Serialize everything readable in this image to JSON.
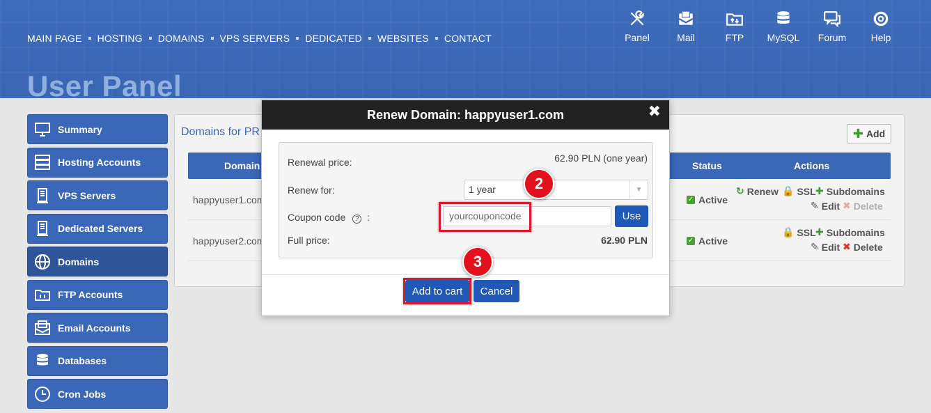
{
  "nav": {
    "items": [
      "MAIN PAGE",
      "HOSTING",
      "DOMAINS",
      "VPS SERVERS",
      "DEDICATED",
      "WEBSITES",
      "CONTACT"
    ]
  },
  "tools": [
    {
      "label": "Panel",
      "icon": "tools-icon"
    },
    {
      "label": "Mail",
      "icon": "mail-icon"
    },
    {
      "label": "FTP",
      "icon": "ftp-folder-icon"
    },
    {
      "label": "MySQL",
      "icon": "database-icon"
    },
    {
      "label": "Forum",
      "icon": "forum-icon"
    },
    {
      "label": "Help",
      "icon": "lifebuoy-icon"
    }
  ],
  "page_title": "User Panel",
  "sidebar": {
    "items": [
      {
        "label": "Summary",
        "icon": "monitor-icon"
      },
      {
        "label": "Hosting Accounts",
        "icon": "server-icon"
      },
      {
        "label": "VPS Servers",
        "icon": "vps-icon"
      },
      {
        "label": "Dedicated Servers",
        "icon": "dedicated-icon"
      },
      {
        "label": "Domains",
        "icon": "www-globe-icon",
        "active": true
      },
      {
        "label": "FTP Accounts",
        "icon": "ftp-folder-icon"
      },
      {
        "label": "Email Accounts",
        "icon": "email-icon"
      },
      {
        "label": "Databases",
        "icon": "database-icon"
      },
      {
        "label": "Cron Jobs",
        "icon": "clock-icon"
      }
    ]
  },
  "panel": {
    "title": "Domains for PR",
    "add_label": "Add",
    "columns": {
      "domain": "Domain",
      "status": "Status",
      "actions": "Actions"
    },
    "rows": [
      {
        "domain": "happyuser1.com",
        "status": "Active",
        "actions": {
          "renew": "Renew",
          "ssl": "SSL",
          "subdomains": "Subdomains",
          "edit": "Edit",
          "delete": "Delete"
        }
      },
      {
        "domain": "happyuser2.com",
        "status": "Active",
        "actions": {
          "ssl": "SSL",
          "subdomains": "Subdomains",
          "edit": "Edit",
          "delete": "Delete"
        }
      }
    ]
  },
  "modal": {
    "title": "Renew Domain: happyuser1.com",
    "renewal_price_label": "Renewal price:",
    "renewal_price_value": "62.90 PLN (one year)",
    "renew_for_label": "Renew for:",
    "renew_for_value": "1 year",
    "coupon_label": "Coupon code",
    "coupon_colon": ":",
    "coupon_value": "yourcouponcode",
    "use_label": "Use",
    "full_price_label": "Full price:",
    "full_price_value": "62.90 PLN",
    "add_to_cart_label": "Add to cart",
    "cancel_label": "Cancel",
    "close_glyph": "✖"
  },
  "badges": {
    "coupon_step": "2",
    "cart_step": "3"
  },
  "colors": {
    "brand": "#3a67b8",
    "highlight": "#e0162b",
    "button": "#1f59b5",
    "active_green": "#4d9c3a"
  }
}
